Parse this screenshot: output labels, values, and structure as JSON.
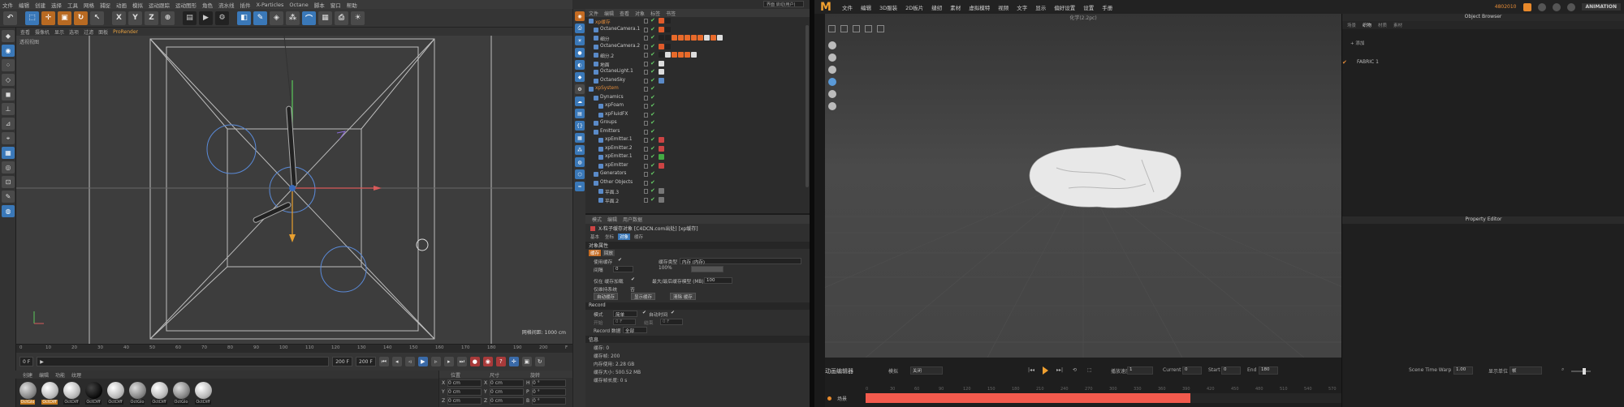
{
  "c4d": {
    "menu": [
      "文件",
      "编辑",
      "创建",
      "选择",
      "工具",
      "网格",
      "捕捉",
      "动画",
      "模拟",
      "运动跟踪",
      "运动图形",
      "角色",
      "流水线",
      "插件",
      "X-Particles",
      "Octane",
      "脚本",
      "窗口",
      "帮助"
    ],
    "layout_label": "界面 启动(用户)",
    "toolbar_icons": [
      "undo-icon",
      "select-icon",
      "move-icon",
      "scale-icon",
      "rotate-icon",
      "cursor-icon",
      "x-axis-icon",
      "y-axis-icon",
      "z-axis-icon",
      "coord-icon",
      "film-icon",
      "render-icon",
      "render-settings-icon",
      "cube-icon",
      "pen-icon",
      "subdiv-icon",
      "array-icon",
      "deformer-icon",
      "scene-icon",
      "camera-icon",
      "light-icon"
    ],
    "axis_labels": {
      "x": "X",
      "y": "Y",
      "z": "Z"
    },
    "viewport_menu": [
      "查看",
      "摄像机",
      "显示",
      "选项",
      "过滤",
      "面板"
    ],
    "viewport_prorender": "ProRender",
    "viewport_label": "透视视图",
    "grid_size": "网格间距: 1000 cm",
    "ruler": [
      "0",
      "10",
      "20",
      "30",
      "40",
      "50",
      "60",
      "70",
      "80",
      "90",
      "100",
      "110",
      "120",
      "130",
      "140",
      "150",
      "160",
      "170",
      "180",
      "190",
      "200",
      "F"
    ],
    "frame_start": "0 F",
    "frame_mid": "0 F",
    "frame_end": "200 F",
    "frame_end2": "200 F",
    "material_menu": [
      "创建",
      "编辑",
      "功能",
      "纹理"
    ],
    "materials": [
      {
        "name": "OctGlo",
        "style": "gray",
        "orange": true
      },
      {
        "name": "OctDiff",
        "style": "white",
        "orange": true
      },
      {
        "name": "OctDiff",
        "style": "white",
        "orange": false
      },
      {
        "name": "OctDiff",
        "style": "black",
        "orange": false
      },
      {
        "name": "OctDiff",
        "style": "white",
        "orange": false
      },
      {
        "name": "OctGlo",
        "style": "gray",
        "orange": false
      },
      {
        "name": "OctDiff",
        "style": "white",
        "orange": false
      },
      {
        "name": "OctGlo",
        "style": "gray",
        "orange": false
      },
      {
        "name": "OctDiff",
        "style": "white",
        "orange": false
      }
    ],
    "coord_headers": {
      "pos": "位置",
      "size": "尺寸",
      "rot": "旋转"
    },
    "coords": [
      {
        "axis": "X",
        "pos": "0 cm",
        "size": "0 cm",
        "rot_axis": "H",
        "rot": "0 °"
      },
      {
        "axis": "Y",
        "pos": "0 cm",
        "size": "0 cm",
        "rot_axis": "P",
        "rot": "0 °"
      },
      {
        "axis": "Z",
        "pos": "0 cm",
        "size": "0 cm",
        "rot_axis": "B",
        "rot": "0 °"
      }
    ],
    "object_menu": [
      "文件",
      "编辑",
      "查看",
      "对象",
      "标签",
      "书签"
    ],
    "objects": [
      {
        "name": "xp缓存",
        "indent": 0,
        "hl": true,
        "tags": [
          "#e05b2a",
          "#222"
        ]
      },
      {
        "name": "OctaneCamera.1",
        "indent": 1,
        "hl": false,
        "tags": [
          "#e05b2a",
          "#222"
        ]
      },
      {
        "name": "细分",
        "indent": 1,
        "hl": false,
        "tags": [
          "#222",
          "#222",
          "#e86a2a",
          "#e86a2a",
          "#e86a2a",
          "#e86a2a",
          "#e86a2a",
          "#ddd",
          "#e86a2a",
          "#ddd"
        ]
      },
      {
        "name": "OctaneCamera.2",
        "indent": 1,
        "hl": false,
        "tags": [
          "#e05b2a",
          "#222"
        ]
      },
      {
        "name": "细分.2",
        "indent": 1,
        "hl": false,
        "tags": [
          "#222",
          "#ddd",
          "#e86a2a",
          "#e86a2a",
          "#e86a2a",
          "#ddd"
        ]
      },
      {
        "name": "地面",
        "indent": 1,
        "hl": false,
        "tags": [
          "#ddd"
        ]
      },
      {
        "name": "OctaneLight.1",
        "indent": 1,
        "hl": false,
        "tags": [
          "#ddd"
        ]
      },
      {
        "name": "OctaneSky",
        "indent": 1,
        "hl": false,
        "tags": [
          "#5a8ac8"
        ]
      },
      {
        "name": "xpSystem",
        "indent": 0,
        "hl": true,
        "tags": []
      },
      {
        "name": "Dynamics",
        "indent": 1,
        "hl": false,
        "tags": []
      },
      {
        "name": "xpFoam",
        "indent": 2,
        "hl": false,
        "tags": []
      },
      {
        "name": "xpFluidFX",
        "indent": 2,
        "hl": false,
        "tags": []
      },
      {
        "name": "Groups",
        "indent": 1,
        "hl": false,
        "tags": []
      },
      {
        "name": "Emitters",
        "indent": 1,
        "hl": false,
        "tags": []
      },
      {
        "name": "xpEmitter.1",
        "indent": 2,
        "hl": false,
        "tags": [
          "#c44"
        ]
      },
      {
        "name": "xpEmitter.2",
        "indent": 2,
        "hl": false,
        "tags": [
          "#c44"
        ]
      },
      {
        "name": "xpEmitter.1",
        "indent": 2,
        "hl": false,
        "tags": [
          "#4a4"
        ]
      },
      {
        "name": "xpEmitter",
        "indent": 2,
        "hl": false,
        "tags": [
          "#c44"
        ]
      },
      {
        "name": "Generators",
        "indent": 1,
        "hl": false,
        "tags": []
      },
      {
        "name": "Other Objects",
        "indent": 1,
        "hl": false,
        "tags": []
      },
      {
        "name": "平面.3",
        "indent": 2,
        "hl": false,
        "tags": [
          "#777"
        ]
      },
      {
        "name": "平面.2",
        "indent": 2,
        "hl": false,
        "tags": [
          "#777"
        ]
      }
    ],
    "attr_menu": [
      "模式",
      "编辑",
      "用户数据"
    ],
    "attr_title": "X-粒子缓存对象 [C4DCN.com出处] [xp缓存]",
    "attr_tabs": [
      "基本",
      "坐标",
      "对象",
      "缓存"
    ],
    "attr_section": "对象属性",
    "attr_subtabs": [
      "缓存",
      "回放"
    ],
    "fields": {
      "use_cache": "使用缓存",
      "cache_type_label": "缓存类型",
      "cache_type": "内存 (内存)",
      "interval_label": "间隔",
      "interval": "0",
      "mem_label": "100%",
      "allow_cache": "仅在 缓存加载",
      "max_mem_label": "最大/最后缓存模型 (MB)",
      "max_mem": "100",
      "compress_label": "仅维持系统",
      "compress": "否",
      "btn1": "自动缓存",
      "btn2": "显示缓存",
      "btn3": "清除 缓存",
      "record_section": "Record",
      "mode_label": "模式",
      "mode": "简单",
      "auto_time_label": "自动时间",
      "start_label": "开始",
      "start": "0 F",
      "end_label": "结束",
      "end": "0 F",
      "record_data_label": "Record 数据",
      "record_data": "全部",
      "info_section": "信息",
      "info1": "缓存: 0",
      "info2": "缓存帧: 200",
      "info3": "内存使用: 2.28 GB",
      "info4": "缓存大小: 500.52 MB",
      "info5": "缓存帧长度: 0 s"
    }
  },
  "md": {
    "menu": [
      "文件",
      "编辑",
      "3D服装",
      "2D板片",
      "缝纫",
      "素材",
      "虚拟模特",
      "视频",
      "文字",
      "显示",
      "偏好设置",
      "设置",
      "手册"
    ],
    "user": "4802010",
    "mode": "ANIMATION",
    "viewport_title": "化学(2.2pc)",
    "panel_title": "Object Browser",
    "panel_tabs": [
      "场景",
      "织物",
      "材质",
      "素材"
    ],
    "add_label": "+ 添加",
    "fabric_name": "FABRIC 1",
    "property_title": "Property Editor",
    "timeline_title": "动画编辑器",
    "bake_label": "模拟",
    "bake_value": "关闭",
    "speed_label": "播放速度",
    "speed_value": "1",
    "current_label": "Current",
    "current_value": "0",
    "start_label": "Start",
    "start_value": "0",
    "end_label": "End",
    "end_value": "180",
    "timewarp_label": "Scene Time Warp",
    "timewarp_value": "1.00",
    "unit_label": "显示单位",
    "unit_value": "帧",
    "ruler": [
      "0",
      "30",
      "60",
      "90",
      "120",
      "150",
      "180",
      "210",
      "240",
      "270",
      "300",
      "330",
      "360",
      "390",
      "420",
      "450",
      "480",
      "510",
      "540",
      "570"
    ],
    "track_label": "场景"
  },
  "colors": {
    "accent_orange": "#e8892b",
    "md_track": "#f35a4d",
    "c4d_blue": "#3a78b8"
  }
}
